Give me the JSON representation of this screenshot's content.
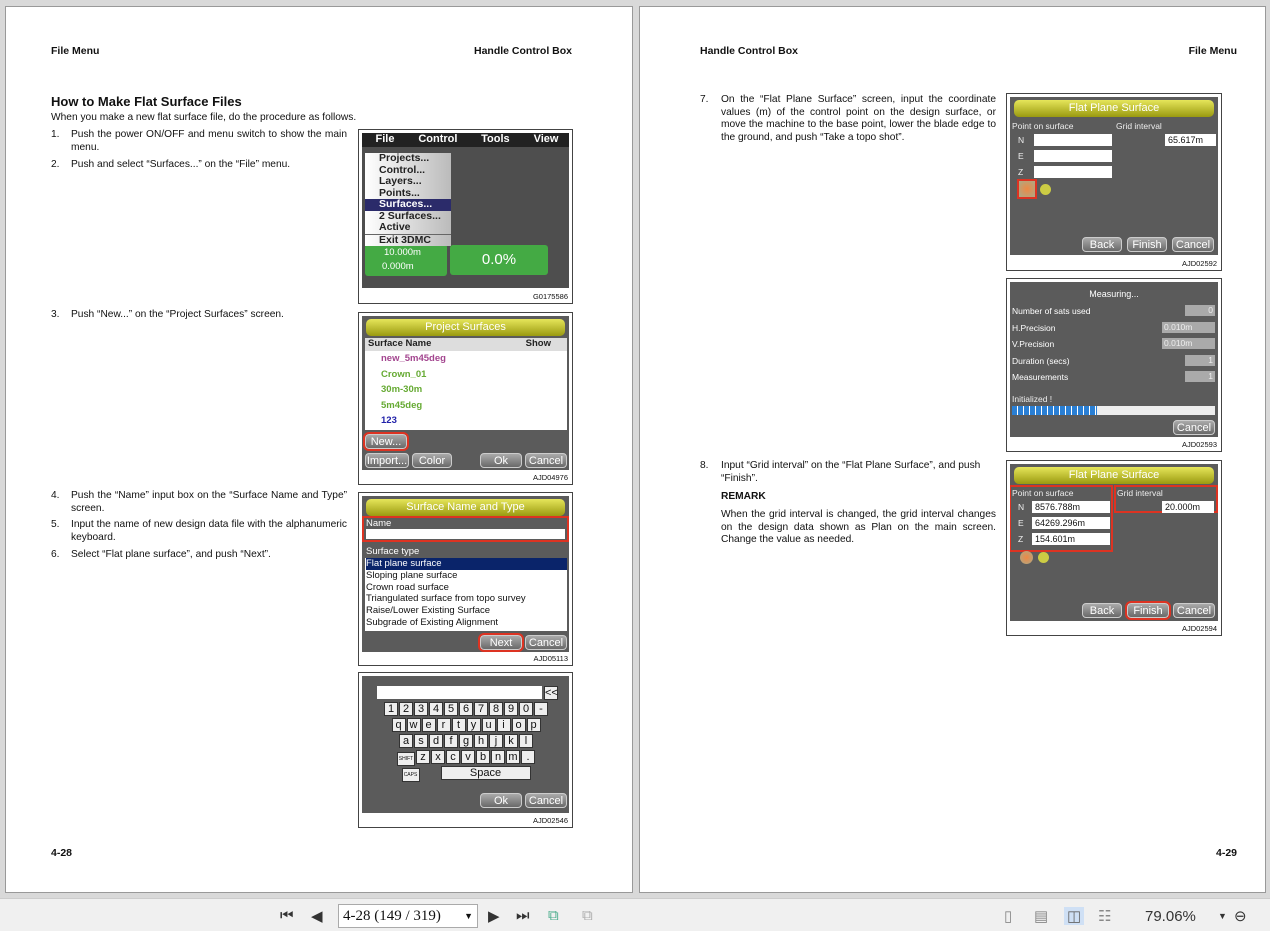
{
  "left_page": {
    "header_left": "File Menu",
    "header_right": "Handle Control Box",
    "title": "How to Make Flat Surface Files",
    "intro": "When you make a new flat surface file, do the procedure as follows.",
    "steps": [
      {
        "n": "1.",
        "text": "Push the power ON/OFF and menu switch to show the main menu."
      },
      {
        "n": "2.",
        "text": "Push and select “Surfaces...” on the “File” menu."
      },
      {
        "n": "3.",
        "text": "Push “New...” on the “Project Surfaces” screen."
      },
      {
        "n": "4.",
        "text": "Push the “Name” input box on the “Surface Name and Type” screen."
      },
      {
        "n": "5.",
        "text": "Input the name of new design data file with the alphanumeric keyboard."
      },
      {
        "n": "6.",
        "text": "Select “Flat plane surface”, and push “Next”."
      }
    ],
    "page_number": "4-28",
    "fig_menu": {
      "menus": [
        "File",
        "Control",
        "Tools",
        "View"
      ],
      "items": [
        "Projects...",
        "Control...",
        "Layers...",
        "Points...",
        "Surfaces...",
        "2 Surfaces...",
        "Active",
        "Exit 3DMC"
      ],
      "readout1": "10.000m",
      "readout2": "0.000m",
      "percent": "0.0%",
      "code": "G0175586"
    },
    "fig_project": {
      "title": "Project Surfaces",
      "col_name": "Surface Name",
      "col_show": "Show",
      "rows": [
        "new_5m45deg",
        "Crown_01",
        "30m-30m",
        "5m45deg",
        "123"
      ],
      "new": "New...",
      "import": "Import...",
      "color": "Color",
      "ok": "Ok",
      "cancel": "Cancel",
      "code": "AJD04976"
    },
    "fig_name": {
      "title": "Surface Name and Type",
      "name_label": "Name",
      "type_label": "Surface type",
      "types": [
        "Flat plane surface",
        "Sloping plane surface",
        "Crown road surface",
        "Triangulated surface from topo survey",
        "Raise/Lower Existing Surface",
        "Subgrade of Existing Alignment"
      ],
      "next": "Next",
      "cancel": "Cancel",
      "code": "AJD05113"
    },
    "fig_keyboard": {
      "back": "<<",
      "rows": [
        [
          "1",
          "2",
          "3",
          "4",
          "5",
          "6",
          "7",
          "8",
          "9",
          "0",
          "-"
        ],
        [
          "q",
          "w",
          "e",
          "r",
          "t",
          "y",
          "u",
          "i",
          "o",
          "p"
        ],
        [
          "a",
          "s",
          "d",
          "f",
          "g",
          "h",
          "j",
          "k",
          "l"
        ],
        [
          "SHIFT",
          "z",
          "x",
          "c",
          "v",
          "b",
          "n",
          "m",
          "."
        ],
        [
          "CAPS",
          "Space"
        ]
      ],
      "ok": "Ok",
      "cancel": "Cancel",
      "code": "AJD02546"
    }
  },
  "right_page": {
    "header_left": "Handle Control Box",
    "header_right": "File Menu",
    "step7": {
      "n": "7.",
      "text": "On the “Flat Plane Surface” screen, input the coordinate values (m) of the control point on the design surface, or move the machine to the base point, lower the blade edge to the ground, and push “Take a topo shot”."
    },
    "step8": {
      "n": "8.",
      "text": "Input “Grid interval” on the “Flat Plane Surface”, and push “Finish”."
    },
    "remark_title": "REMARK",
    "remark": "When the grid interval is changed, the grid interval changes on the design data shown as Plan on the main screen. Change the value as needed.",
    "page_number": "4-29",
    "fig_flat1": {
      "title": "Flat Plane Surface",
      "point_label": "Point on surface",
      "grid_label": "Grid interval",
      "n": "N",
      "e": "E",
      "z": "Z",
      "grid": "65.617m",
      "back": "Back",
      "finish": "Finish",
      "cancel": "Cancel",
      "code": "AJD02592"
    },
    "fig_measure": {
      "title": "Measuring...",
      "rows": [
        {
          "label": "Number of sats used",
          "value": "0"
        },
        {
          "label": "H.Precision",
          "value": "0.010m"
        },
        {
          "label": "V.Precision",
          "value": "0.010m"
        },
        {
          "label": "Duration (secs)",
          "value": "1"
        },
        {
          "label": "Measurements",
          "value": "1"
        }
      ],
      "status": "Initialized !",
      "progress": 0.42,
      "cancel": "Cancel",
      "code": "AJD02593"
    },
    "fig_flat2": {
      "title": "Flat Plane Surface",
      "point_label": "Point on surface",
      "grid_label": "Grid interval",
      "n": "N",
      "e": "E",
      "z": "Z",
      "n_val": "8576.788m",
      "e_val": "64269.296m",
      "z_val": "154.601m",
      "grid": "20.000m",
      "back": "Back",
      "finish": "Finish",
      "cancel": "Cancel",
      "code": "AJD02594"
    }
  },
  "toolbar": {
    "page_field": "4-28 (149 / 319)",
    "zoom": "79.06%"
  }
}
